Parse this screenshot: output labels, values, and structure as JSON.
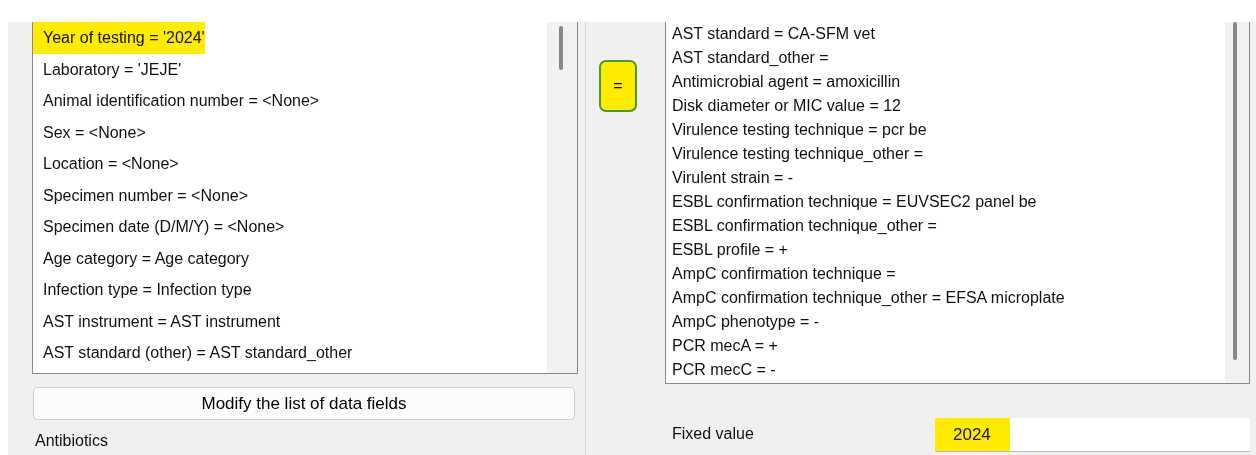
{
  "field_list": {
    "items": [
      {
        "text": "Year of testing = '2024'",
        "highlighted": true
      },
      {
        "text": "Laboratory = 'JEJE'",
        "highlighted": false
      },
      {
        "text": "Animal identification number = <None>",
        "highlighted": false
      },
      {
        "text": "Sex = <None>",
        "highlighted": false
      },
      {
        "text": "Location = <None>",
        "highlighted": false
      },
      {
        "text": "Specimen number = <None>",
        "highlighted": false
      },
      {
        "text": "Specimen date (D/M/Y) = <None>",
        "highlighted": false
      },
      {
        "text": "Age category = Age category",
        "highlighted": false
      },
      {
        "text": "Infection type = Infection type",
        "highlighted": false
      },
      {
        "text": "AST instrument = AST instrument",
        "highlighted": false
      },
      {
        "text": "AST standard (other) = AST standard_other",
        "highlighted": false
      }
    ]
  },
  "modify_button": {
    "label": "Modify the list of data fields"
  },
  "section_label": "Antibiotics",
  "equals_button": {
    "label": "=",
    "highlighted": true
  },
  "value_list": {
    "items": [
      "AST standard = CA-SFM vet",
      "AST standard_other =",
      "Antimicrobial agent = amoxicillin",
      "Disk diameter or MIC value = 12",
      "Virulence testing technique = pcr be",
      "Virulence testing technique_other =",
      "Virulent strain = -",
      "ESBL confirmation technique = EUVSEC2 panel be",
      "ESBL confirmation technique_other =",
      "ESBL profile = +",
      "AmpC confirmation technique =",
      "AmpC confirmation technique_other = EFSA microplate",
      "AmpC phenotype = -",
      "PCR mecA = +",
      "PCR mecC = -"
    ]
  },
  "fixed_value": {
    "label": "Fixed value",
    "value": "2024",
    "highlighted": true
  }
}
